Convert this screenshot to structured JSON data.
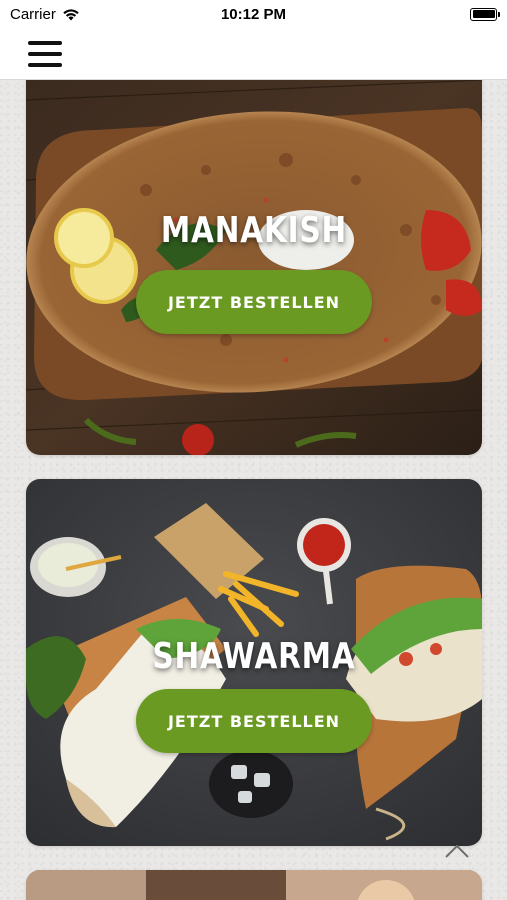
{
  "status_bar": {
    "carrier": "Carrier",
    "time": "10:12 PM"
  },
  "nav": {
    "menu_icon": "hamburger-menu-icon"
  },
  "menu_items": [
    {
      "title": "MANAKISH",
      "button_label": "JETZT BESTELLEN"
    },
    {
      "title": "SHAWARMA",
      "button_label": "JETZT BESTELLEN"
    }
  ],
  "scroll_icon": "chevron-up-icon",
  "colors": {
    "button_green": "#6b9a23",
    "background": "#e9e8e6"
  }
}
